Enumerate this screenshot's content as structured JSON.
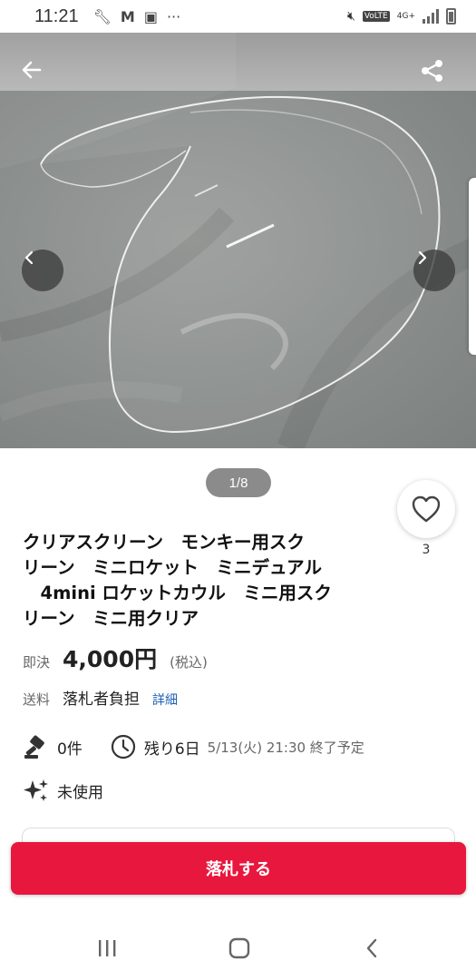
{
  "status_bar": {
    "time": "11:21",
    "left_icons": [
      "wrench-icon",
      "gmail-icon",
      "app-icon",
      "more-icon"
    ],
    "network_badge": "VoLTE",
    "network_type": "4G+"
  },
  "listing": {
    "image_counter": "1/8",
    "watch_count": "3",
    "title_lines": [
      "クリアスクリーン　モンキー用スク",
      "リーン　ミニロケット　ミニデュアル",
      "　4mini ロケットカウル　ミニ用スク",
      "リーン　ミニ用クリア"
    ],
    "price_label": "即決",
    "price": "4,000円",
    "tax_note": "(税込)",
    "shipping_label": "送料",
    "shipping_value": "落札者負担",
    "shipping_detail_link": "詳細",
    "bid_count": "0件",
    "time_left": "残り6日",
    "end_date": "5/13(火) 21:30 終了予定",
    "condition": "未使用"
  },
  "actions": {
    "bid_button": "落札する"
  },
  "colors": {
    "accent_red": "#e8173e",
    "link_blue": "#1a5fb4"
  }
}
